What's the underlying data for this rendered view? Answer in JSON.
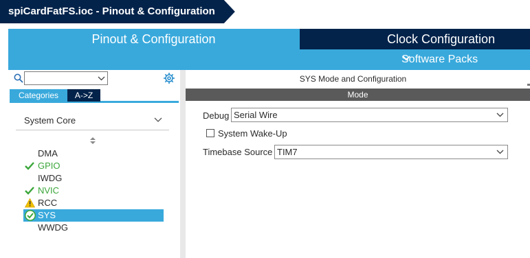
{
  "breadcrumb": {
    "title": "spiCardFatFS.ioc - Pinout & Configuration"
  },
  "tabs": {
    "pinout": "Pinout & Configuration",
    "clock": "Clock Configuration",
    "software_packs": "Software Packs"
  },
  "left": {
    "search": {
      "value": ""
    },
    "category_tabs": {
      "categories": "Categories",
      "az": "A->Z"
    },
    "group": "System Core",
    "items": [
      {
        "label": "DMA",
        "status": "none"
      },
      {
        "label": "GPIO",
        "status": "ok"
      },
      {
        "label": "IWDG",
        "status": "none"
      },
      {
        "label": "NVIC",
        "status": "ok"
      },
      {
        "label": "RCC",
        "status": "warning"
      },
      {
        "label": "SYS",
        "status": "ok-selected"
      },
      {
        "label": "WWDG",
        "status": "none"
      }
    ]
  },
  "right": {
    "header": "SYS Mode and Configuration",
    "mode_bar": "Mode",
    "debug_label": "Debug",
    "debug_value": "Serial Wire",
    "wakeup_label": "System Wake-Up",
    "wakeup_checked": false,
    "timebase_label": "Timebase Source",
    "timebase_value": "TIM7"
  },
  "colors": {
    "navy": "#03234b",
    "accent_blue": "#39a9dc",
    "ok_green": "#3aa63a",
    "warning_yellow": "#f2c200",
    "mode_bar_gray": "#5a5a5a"
  }
}
